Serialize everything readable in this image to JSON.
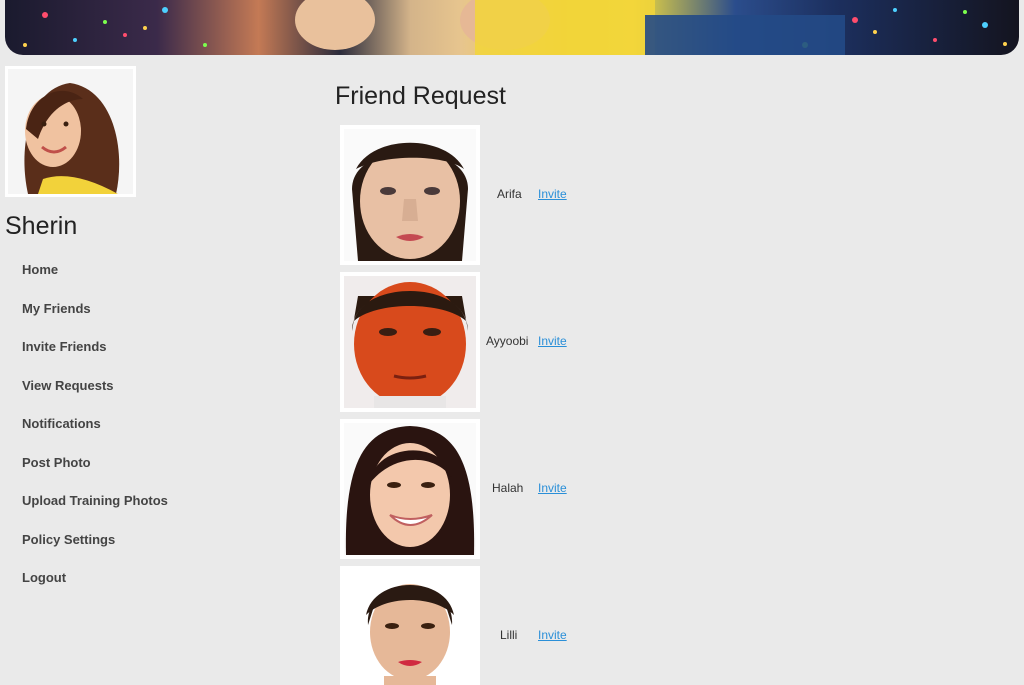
{
  "banner": {
    "icon": "party-banner-image"
  },
  "profile": {
    "name": "Sherin",
    "avatar_icon": "profile-photo"
  },
  "nav": {
    "items": [
      {
        "label": "Home"
      },
      {
        "label": "My Friends"
      },
      {
        "label": "Invite Friends"
      },
      {
        "label": "View Requests"
      },
      {
        "label": "Notifications"
      },
      {
        "label": "Post Photo"
      },
      {
        "label": "Upload Training Photos"
      },
      {
        "label": "Policy  Settings"
      },
      {
        "label": "Logout"
      }
    ]
  },
  "main": {
    "title": "Friend Request",
    "requests": [
      {
        "name": "Arifa",
        "action": "Invite"
      },
      {
        "name": "Ayyoobi",
        "action": "Invite"
      },
      {
        "name": "Halah",
        "action": "Invite"
      },
      {
        "name": "Lilli",
        "action": "Invite"
      }
    ]
  },
  "colors": {
    "background": "#eaeaea",
    "link": "#2a8fd8",
    "nav_text": "#444444"
  }
}
